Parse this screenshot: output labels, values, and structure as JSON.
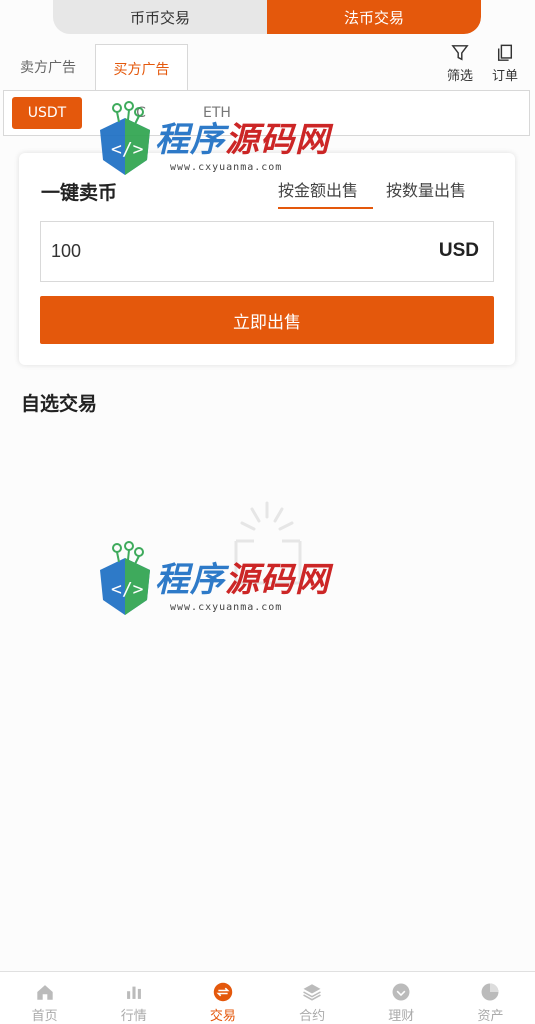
{
  "top_switch": {
    "coin_trade": "币币交易",
    "fiat_trade": "法币交易"
  },
  "ad_tabs": {
    "sell_ads": "卖方广告",
    "buy_ads": "买方广告"
  },
  "tools": {
    "filter": "筛选",
    "orders": "订单"
  },
  "coins": {
    "usdt": "USDT",
    "btc": "C",
    "eth": "ETH"
  },
  "quick_sell": {
    "title": "一键卖币",
    "by_amount": "按金额出售",
    "by_quantity": "按数量出售",
    "amount_value": "100",
    "unit": "USD",
    "sell_button": "立即出售"
  },
  "favorites_title": "自选交易",
  "watermark": {
    "name_blue": "程序",
    "name_red": "源码网",
    "url": "www.cxyuanma.com"
  },
  "bottom_nav": [
    {
      "label": "首页",
      "icon": "home-icon"
    },
    {
      "label": "行情",
      "icon": "chart-icon"
    },
    {
      "label": "交易",
      "icon": "exchange-icon"
    },
    {
      "label": "合约",
      "icon": "layers-icon"
    },
    {
      "label": "理财",
      "icon": "wallet-icon"
    },
    {
      "label": "资产",
      "icon": "pie-icon"
    }
  ],
  "colors": {
    "accent": "#e4580c"
  }
}
